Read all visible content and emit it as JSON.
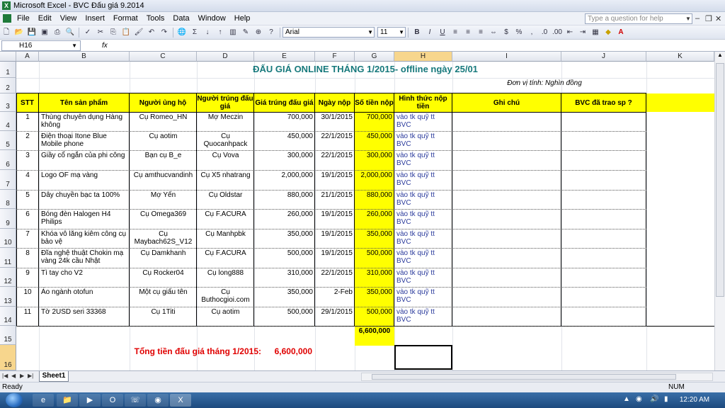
{
  "window": {
    "title": "Microsoft Excel - BVC Đấu giá 9.2014"
  },
  "menu": [
    "File",
    "Edit",
    "View",
    "Insert",
    "Format",
    "Tools",
    "Data",
    "Window",
    "Help"
  ],
  "help_placeholder": "Type a question for help",
  "toolbar": {
    "font": "Arial",
    "size": "11"
  },
  "formula_bar": {
    "name_box": "H16",
    "fx": "fx"
  },
  "columns": [
    "A",
    "B",
    "C",
    "D",
    "E",
    "F",
    "G",
    "H",
    "I",
    "J",
    "K"
  ],
  "rows": [
    "1",
    "2",
    "3",
    "4",
    "5",
    "6",
    "7",
    "8",
    "9",
    "10",
    "11",
    "12",
    "13",
    "14",
    "15",
    "16"
  ],
  "sheet": {
    "title": "ĐẤU GIÁ ONLINE THÁNG 1/2015- offline ngày 25/01",
    "unit": "Đơn vị tính: Nghìn đồng",
    "headers": [
      "STT",
      "Tên sản phẩm",
      "Người ủng hộ",
      "Người trúng đấu giá",
      "Giá trúng đấu giá",
      "Ngày nộp",
      "Số tiền nộp",
      "Hình thức nộp tiền",
      "Ghi chú",
      "BVC đã trao sp ?"
    ],
    "items": [
      {
        "stt": "1",
        "name": "Thùng chuyên dụng Hàng không",
        "donor": "Cụ Romeo_HN",
        "winner": "Mợ Meczin",
        "price": "700,000",
        "date": "30/1/2015",
        "paid": "700,000",
        "method": "vào tk quỹ tt BVC"
      },
      {
        "stt": "2",
        "name": "Điện thoại Itone Blue Mobile phone",
        "donor": "Cụ aotim",
        "winner": "Cụ Quocanhpack",
        "price": "450,000",
        "date": "22/1/2015",
        "paid": "450,000",
        "method": "vào tk quỹ tt BVC"
      },
      {
        "stt": "3",
        "name": "Giầy cổ ngắn của phi công",
        "donor": "Bạn cụ B_e",
        "winner": "Cụ Vova",
        "price": "300,000",
        "date": "22/1/2015",
        "paid": "300,000",
        "method": "vào tk quỹ tt BVC"
      },
      {
        "stt": "4",
        "name": "Logo OF mạ vàng",
        "donor": "Cụ amthucvandinh",
        "winner": "Cụ X5 nhatrang",
        "price": "2,000,000",
        "date": "19/1/2015",
        "paid": "2,000,000",
        "method": "vào tk quỹ tt BVC"
      },
      {
        "stt": "5",
        "name": "Dây chuyền bạc ta 100%",
        "donor": "Mợ Yến",
        "winner": "Cụ Oldstar",
        "price": "880,000",
        "date": "21/1/2015",
        "paid": "880,000",
        "method": "vào tk quỹ tt BVC"
      },
      {
        "stt": "6",
        "name": "Bóng đèn Halogen H4 Philips",
        "donor": "Cụ Omega369",
        "winner": "Cụ F.ACURA",
        "price": "260,000",
        "date": "19/1/2015",
        "paid": "260,000",
        "method": "vào tk quỹ tt BVC"
      },
      {
        "stt": "7",
        "name": "Khóa vô lăng kiêm công cụ bảo vệ",
        "donor": "Cụ Maybach62S_V12",
        "winner": "Cụ Manhpbk",
        "price": "350,000",
        "date": "19/1/2015",
        "paid": "350,000",
        "method": "vào tk quỹ tt BVC"
      },
      {
        "stt": "8",
        "name": "Đĩa nghệ thuật Chokin mạ vàng 24k cầu Nhật",
        "donor": "Cụ Damkhanh",
        "winner": "Cụ F.ACURA",
        "price": "500,000",
        "date": "19/1/2015",
        "paid": "500,000",
        "method": "vào tk quỹ tt BVC"
      },
      {
        "stt": "9",
        "name": "Tì tay cho V2",
        "donor": "Cụ Rocker04",
        "winner": "Cụ long888",
        "price": "310,000",
        "date": "22/1/2015",
        "paid": "310,000",
        "method": "vào tk quỹ tt BVC"
      },
      {
        "stt": "10",
        "name": "Áo ngành otofun",
        "donor": "Một cụ giấu tên",
        "winner": "Cụ Buthocgioi.com",
        "price": "350,000",
        "date": "2-Feb",
        "paid": "350,000",
        "method": "vào tk quỹ tt BVC"
      },
      {
        "stt": "11",
        "name": "Tờ 2USD seri 33368",
        "donor": "Cụ 1Titi",
        "winner": "Cụ aotim",
        "price": "500,000",
        "date": "29/1/2015",
        "paid": "500,000",
        "method": "vào tk quỹ tt BVC"
      }
    ],
    "sum_paid": "6,600,000",
    "total_label": "Tổng tiền đấu giá tháng 1/2015:",
    "total_value": "6,600,000"
  },
  "sheet_tab": "Sheet1",
  "status": {
    "ready": "Ready",
    "num": "NUM"
  },
  "clock": "12:20 AM"
}
